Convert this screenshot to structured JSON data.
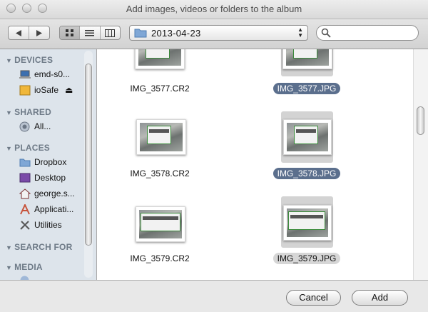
{
  "window": {
    "title": "Add images, videos or folders to the album"
  },
  "toolbar": {
    "back_icon": "back-arrow-icon",
    "forward_icon": "forward-arrow-icon",
    "view_modes": [
      "icon-view",
      "list-view",
      "column-view"
    ],
    "active_view": "icon-view",
    "location": "2013-04-23",
    "search_value": "",
    "search_icon": "magnifier-icon"
  },
  "sidebar": {
    "sections": [
      {
        "label": "DEVICES",
        "items": [
          {
            "label": "emd-s0...",
            "icon": "laptop-icon"
          },
          {
            "label": "ioSafe",
            "icon": "drive-icon",
            "eject": true
          }
        ]
      },
      {
        "label": "SHARED",
        "items": [
          {
            "label": "All...",
            "icon": "network-icon"
          }
        ]
      },
      {
        "label": "PLACES",
        "items": [
          {
            "label": "Dropbox",
            "icon": "folder-icon"
          },
          {
            "label": "Desktop",
            "icon": "desktop-icon"
          },
          {
            "label": "george.s...",
            "icon": "home-icon"
          },
          {
            "label": "Applicati...",
            "icon": "applications-icon"
          },
          {
            "label": "Utilities",
            "icon": "utilities-icon"
          }
        ]
      },
      {
        "label": "SEARCH FOR",
        "items": []
      },
      {
        "label": "MEDIA",
        "items": []
      }
    ]
  },
  "files": [
    {
      "name": "IMG_3577.CR2",
      "selected": false
    },
    {
      "name": "IMG_3577.JPG",
      "selected": true
    },
    {
      "name": "IMG_3578.CR2",
      "selected": false
    },
    {
      "name": "IMG_3578.JPG",
      "selected": true
    },
    {
      "name": "IMG_3579.CR2",
      "selected": false
    },
    {
      "name": "IMG_3579.JPG",
      "selected": true,
      "focused": false
    }
  ],
  "buttons": {
    "cancel": "Cancel",
    "add": "Add"
  },
  "colors": {
    "selection": "#5b6f8d",
    "sidebar_bg": "#dde4eb"
  }
}
